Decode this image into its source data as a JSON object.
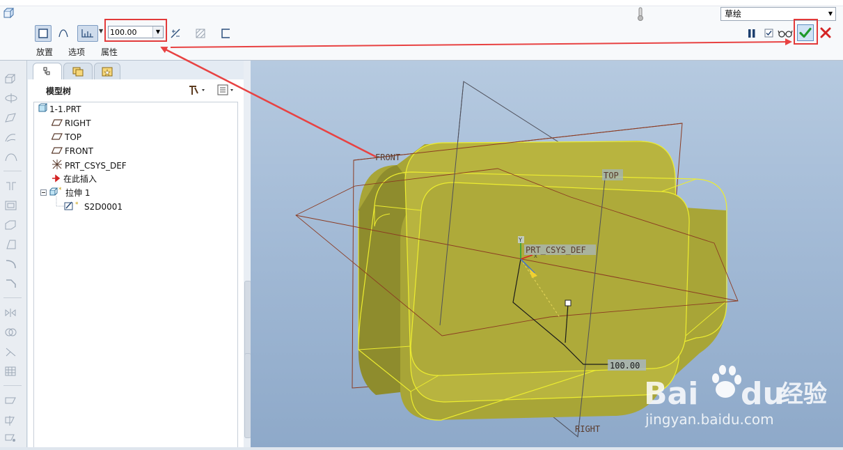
{
  "ribbon": {
    "depth_value": "100.00",
    "tabs": [
      {
        "label": "放置"
      },
      {
        "label": "选项"
      },
      {
        "label": "属性"
      }
    ],
    "mode_select": "草绘"
  },
  "model_tree": {
    "title": "模型树",
    "items": [
      {
        "label": "1-1.PRT",
        "icon": "part-icon"
      },
      {
        "label": "RIGHT",
        "icon": "datum-plane-icon"
      },
      {
        "label": "TOP",
        "icon": "datum-plane-icon"
      },
      {
        "label": "FRONT",
        "icon": "datum-plane-icon"
      },
      {
        "label": "PRT_CSYS_DEF",
        "icon": "csys-icon"
      },
      {
        "label": "在此插入",
        "icon": "insert-arrow-icon"
      },
      {
        "label": "拉伸 1",
        "icon": "extrude-icon"
      },
      {
        "label": "S2D0001",
        "icon": "sketch-icon"
      }
    ]
  },
  "viewport": {
    "labels": {
      "front": "FRONT",
      "top": "TOP",
      "right": "RIGHT",
      "csys": "PRT_CSYS_DEF",
      "dimension": "100.00"
    },
    "watermark": {
      "brand": "Bai",
      "brand2": "du",
      "suffix": "经验",
      "url": "jingyan.baidu.com"
    }
  },
  "colors": {
    "solid": "#b5b23a",
    "edge": "#f2f233",
    "highlight": "#e23a3a",
    "accept": "#1f9a2c",
    "cancel": "#d42424"
  }
}
